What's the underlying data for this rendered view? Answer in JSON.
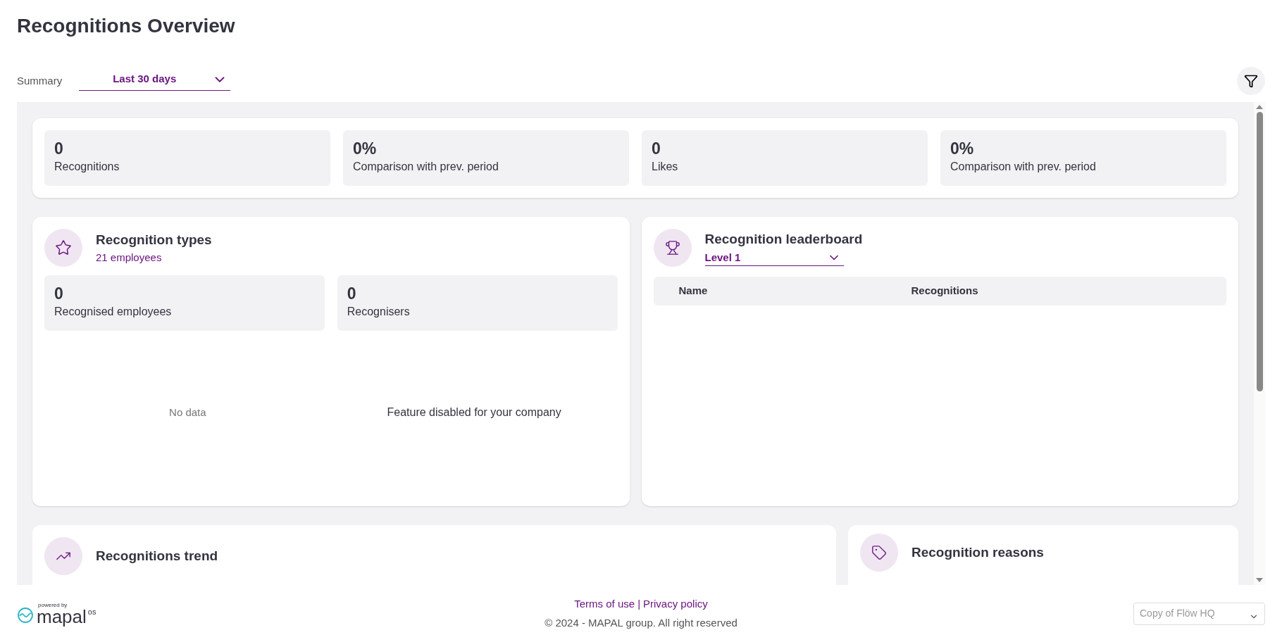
{
  "title": "Recognitions Overview",
  "summary": {
    "label": "Summary",
    "value": "Last 30 days"
  },
  "stats": [
    {
      "value": "0",
      "label": "Recognitions"
    },
    {
      "value": "0%",
      "label": "Comparison with prev. period"
    },
    {
      "value": "0",
      "label": "Likes"
    },
    {
      "value": "0%",
      "label": "Comparison with prev. period"
    }
  ],
  "types_card": {
    "title": "Recognition types",
    "subtitle": "21 employees",
    "stats": [
      {
        "value": "0",
        "label": "Recognised employees"
      },
      {
        "value": "0",
        "label": "Recognisers"
      }
    ],
    "messages": [
      "No data",
      "Feature disabled for your company"
    ]
  },
  "leaderboard": {
    "title": "Recognition leaderboard",
    "level": "Level 1",
    "columns": [
      "Name",
      "Recognitions"
    ]
  },
  "trend_card": {
    "title": "Recognitions trend"
  },
  "reasons_card": {
    "title": "Recognition reasons"
  },
  "footer": {
    "powered_by": "powered by",
    "brand": "mapal",
    "brand_suffix": "os",
    "links": [
      "Terms of use",
      "Privacy policy"
    ],
    "separator": "|",
    "copyright": "© 2024 - MAPAL group. All right reserved",
    "location": "Copy of Flöw HQ"
  }
}
